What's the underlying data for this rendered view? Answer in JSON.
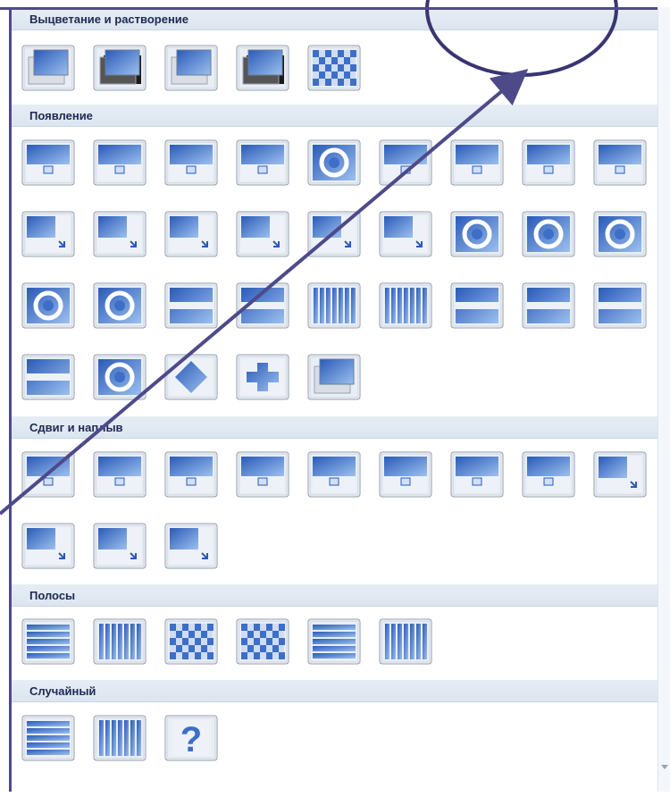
{
  "sections": [
    {
      "title": "Выцветание и растворение",
      "tiles": [
        "fade-smooth-icon",
        "fade-through-black-icon",
        "fade-overlap-icon",
        "fade-black-overlap-icon",
        "dissolve-icon"
      ]
    },
    {
      "title": "Появление",
      "tiles": [
        "cover-down-icon",
        "cover-left-icon",
        "cover-right-icon",
        "cover-up-icon",
        "circle-rotate-icon",
        "push-down-icon",
        "push-left-icon",
        "push-right-icon",
        "push-up-icon",
        "corner-down-left-icon",
        "corner-up-left-icon",
        "corner-down-right-icon",
        "corner-up-right-icon",
        "shrink-corners-icon",
        "expand-corners-icon",
        "wheel-1-icon",
        "wheel-2-icon",
        "wheel-3-icon",
        "wheel-4-icon",
        "wheel-8-icon",
        "split-horizontal-in-icon",
        "split-horizontal-out-icon",
        "split-vertical-in-icon",
        "split-vertical-out-icon",
        "diagonal-down-left-icon",
        "diagonal-up-left-icon",
        "diagonal-down-right-icon",
        "diagonal-up-right-icon",
        "circle-expand-icon",
        "diamond-expand-icon",
        "plus-expand-icon",
        "newsflash-icon"
      ]
    },
    {
      "title": "Сдвиг и наплыв",
      "tiles": [
        "uncover-down-icon",
        "uncover-left-icon",
        "uncover-right-icon",
        "uncover-up-icon",
        "pull-down-icon",
        "pull-left-icon",
        "pull-right-icon",
        "pull-up-icon",
        "uncover-down-left-icon",
        "uncover-up-left-icon",
        "uncover-down-right-icon",
        "uncover-up-right-icon"
      ]
    },
    {
      "title": "Полосы",
      "tiles": [
        "blinds-horizontal-icon",
        "blinds-vertical-icon",
        "checkerboard-across-icon",
        "checkerboard-down-icon",
        "comb-horizontal-icon",
        "comb-vertical-icon"
      ]
    },
    {
      "title": "Случайный",
      "tiles": [
        "random-bars-horizontal-icon",
        "random-bars-vertical-icon",
        "random-transition-icon"
      ]
    }
  ],
  "random_icon_glyph": "?",
  "colors": {
    "accent": "#4e4a8a",
    "tile_blue": "#3d6fc8",
    "header_text": "#1d2a52"
  }
}
